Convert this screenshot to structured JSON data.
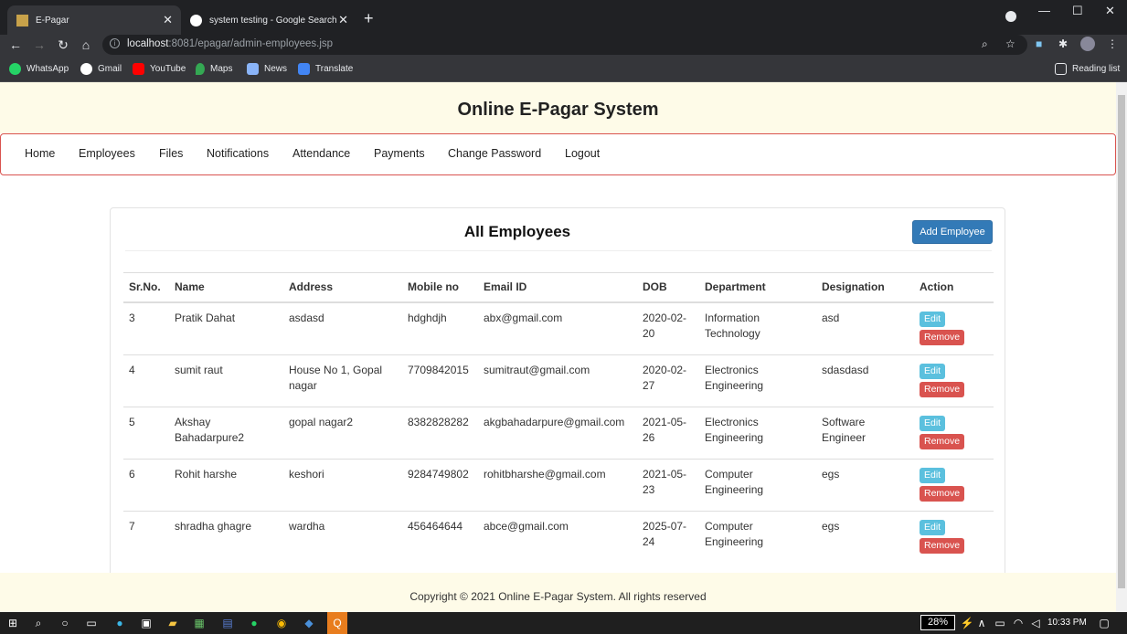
{
  "browser": {
    "tabs": [
      {
        "title": "E-Pagar",
        "active": true
      },
      {
        "title": "system testing - Google Search",
        "active": false
      }
    ],
    "url_host": "localhost",
    "url_path": ":8081/epagar/admin-employees.jsp",
    "bookmarks": [
      "WhatsApp",
      "Gmail",
      "YouTube",
      "Maps",
      "News",
      "Translate"
    ],
    "reading_list": "Reading list"
  },
  "site": {
    "title": "Online E-Pagar System",
    "nav": [
      "Home",
      "Employees",
      "Files",
      "Notifications",
      "Attendance",
      "Payments",
      "Change Password",
      "Logout"
    ]
  },
  "panel": {
    "title": "All Employees",
    "add_button": "Add Employee",
    "columns": [
      "Sr.No.",
      "Name",
      "Address",
      "Mobile no",
      "Email ID",
      "DOB",
      "Department",
      "Designation",
      "Action"
    ],
    "edit_label": "Edit",
    "remove_label": "Remove",
    "rows": [
      {
        "sr": "3",
        "name": "Pratik Dahat",
        "address": "asdasd",
        "mobile": "hdghdjh",
        "email": "abx@gmail.com",
        "dob": "2020-02-20",
        "department": "Information Technology",
        "designation": "asd"
      },
      {
        "sr": "4",
        "name": "sumit raut",
        "address": "House No 1, Gopal nagar",
        "mobile": "7709842015",
        "email": "sumitraut@gmail.com",
        "dob": "2020-02-27",
        "department": "Electronics Engineering",
        "designation": "sdasdasd"
      },
      {
        "sr": "5",
        "name": "Akshay Bahadarpure2",
        "address": "gopal nagar2",
        "mobile": "8382828282",
        "email": "akgbahadarpure@gmail.com",
        "dob": "2021-05-26",
        "department": "Electronics Engineering",
        "designation": "Software Engineer"
      },
      {
        "sr": "6",
        "name": "Rohit harshe",
        "address": "keshori",
        "mobile": "9284749802",
        "email": "rohitbharshe@gmail.com",
        "dob": "2021-05-23",
        "department": "Computer Engineering",
        "designation": "egs"
      },
      {
        "sr": "7",
        "name": "shradha ghagre",
        "address": "wardha",
        "mobile": "456464644",
        "email": "abce@gmail.com",
        "dob": "2025-07-24",
        "department": "Computer Engineering",
        "designation": "egs"
      }
    ]
  },
  "footer": {
    "text": "Copyright © 2021 Online E-Pagar System. All rights reserved"
  },
  "taskbar": {
    "battery": "28%",
    "time": "10:33 PM"
  },
  "colors": {
    "header_bg": "#fefbe8",
    "nav_border": "#d9534f",
    "primary": "#337ab7",
    "info": "#5bc0de",
    "danger": "#d9534f"
  }
}
